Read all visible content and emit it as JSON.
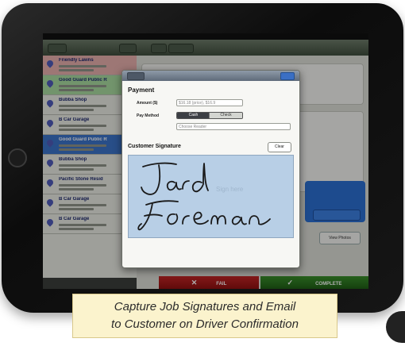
{
  "list": {
    "rows": [
      {
        "name": "Friendly Lawns",
        "color": "#e7b0ad"
      },
      {
        "name": "Good Guard Public R",
        "color": "#a8dba0"
      },
      {
        "name": "Bubba Shop",
        "color": "#e9eae4"
      },
      {
        "name": "B Car Garage",
        "color": "#e9eae4"
      },
      {
        "name": "Good Guard Public R",
        "color": "#3b73c9"
      },
      {
        "name": "Bubba Shop",
        "color": "#e9eae4"
      },
      {
        "name": "Pacific Stone Resid",
        "color": "#e9eae4"
      },
      {
        "name": "B Car Garage",
        "color": "#e9eae4"
      },
      {
        "name": "B Car Garage",
        "color": "#e9eae4"
      }
    ]
  },
  "actions": {
    "fail_label": "FAIL",
    "complete_label": "COMPLETE",
    "view_photos_label": "View Photos"
  },
  "modal": {
    "payment_title": "Payment",
    "amount_label": "Amount ($)",
    "amount_value": "$16.18 (price), $16.9",
    "pay_method_label": "Pay Method",
    "pay_method_options": [
      "Cash",
      "Check"
    ],
    "select_placeholder": "Choose Reader",
    "signature_title": "Customer Signature",
    "clear_label": "Clear",
    "signature_hint": "Sign here"
  },
  "caption": {
    "line1": "Capture Job Signatures and Email",
    "line2": "to Customer on Driver Confirmation"
  },
  "colors": {
    "fail": "#b51d1d",
    "complete": "#2f7d22",
    "brand": "#5fbf3f",
    "signature_bg": "#b8cfe6"
  }
}
